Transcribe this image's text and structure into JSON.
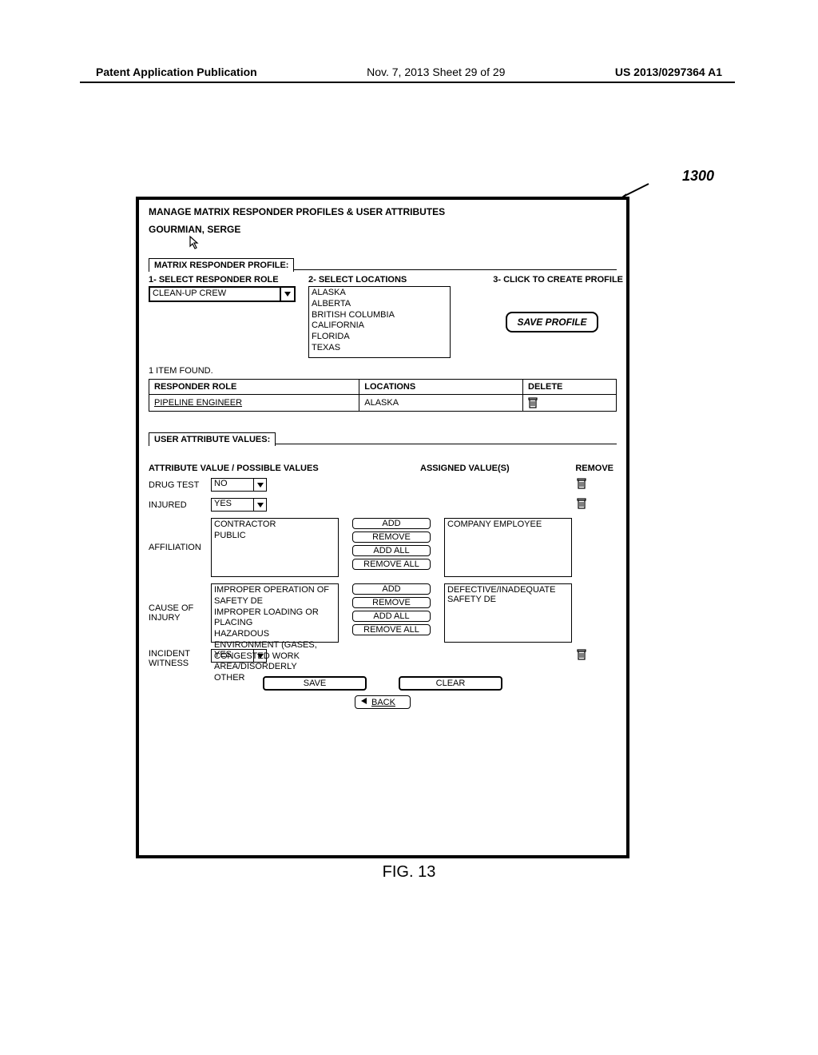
{
  "header": {
    "left": "Patent Application Publication",
    "mid": "Nov. 7, 2013  Sheet 29 of 29",
    "right": "US 2013/0297364 A1"
  },
  "ref": {
    "label": "1300"
  },
  "panel": {
    "title": "MANAGE MATRIX RESPONDER PROFILES & USER ATTRIBUTES",
    "user": "GOURMIAN, SERGE",
    "section_profile_tab": "MATRIX RESPONDER PROFILE:",
    "step1": "1- SELECT RESPONDER ROLE",
    "step2": "2- SELECT LOCATIONS",
    "step3": "3- CLICK TO CREATE PROFILE",
    "role_value": "CLEAN-UP CREW",
    "locations": [
      "ALASKA",
      "ALBERTA",
      "BRITISH COLUMBIA",
      "CALIFORNIA",
      "FLORIDA",
      "TEXAS"
    ],
    "save_profile": "SAVE PROFILE",
    "found": "1 ITEM FOUND.",
    "table": {
      "h1": "RESPONDER ROLE",
      "h2": "LOCATIONS",
      "h3": "DELETE",
      "r1_role": "PIPELINE ENGINEER",
      "r1_loc": "ALASKA"
    },
    "attr_tab": "USER ATTRIBUTE VALUES:",
    "attr_head": "ATTRIBUTE VALUE / POSSIBLE VALUES",
    "assigned_head": "ASSIGNED VALUE(S)",
    "remove_head": "REMOVE",
    "rows": {
      "drug": {
        "label": "DRUG TEST",
        "value": "NO"
      },
      "injured": {
        "label": "INJURED",
        "value": "YES"
      },
      "affiliation": {
        "label": "AFFILIATION",
        "options": [
          "CONTRACTOR",
          "PUBLIC"
        ],
        "assigned": "COMPANY EMPLOYEE"
      },
      "cause": {
        "label": "CAUSE OF INJURY",
        "options": [
          "IMPROPER OPERATION OF SAFETY DE",
          "IMPROPER LOADING OR PLACING",
          "HAZARDOUS ENVIRONMENT (GASES,",
          "CONGESTED WORK AREA/DISORDERLY",
          "OTHER"
        ],
        "assigned": "DEFECTIVE/INADEQUATE SAFETY DE"
      },
      "witness": {
        "label": "INCIDENT WITNESS",
        "value": "YES"
      }
    },
    "btn": {
      "add": "ADD",
      "remove": "REMOVE",
      "addall": "ADD ALL",
      "removeall": "REMOVE ALL",
      "save": "SAVE",
      "clear": "CLEAR",
      "back": "BACK"
    }
  },
  "figure": "FIG. 13"
}
